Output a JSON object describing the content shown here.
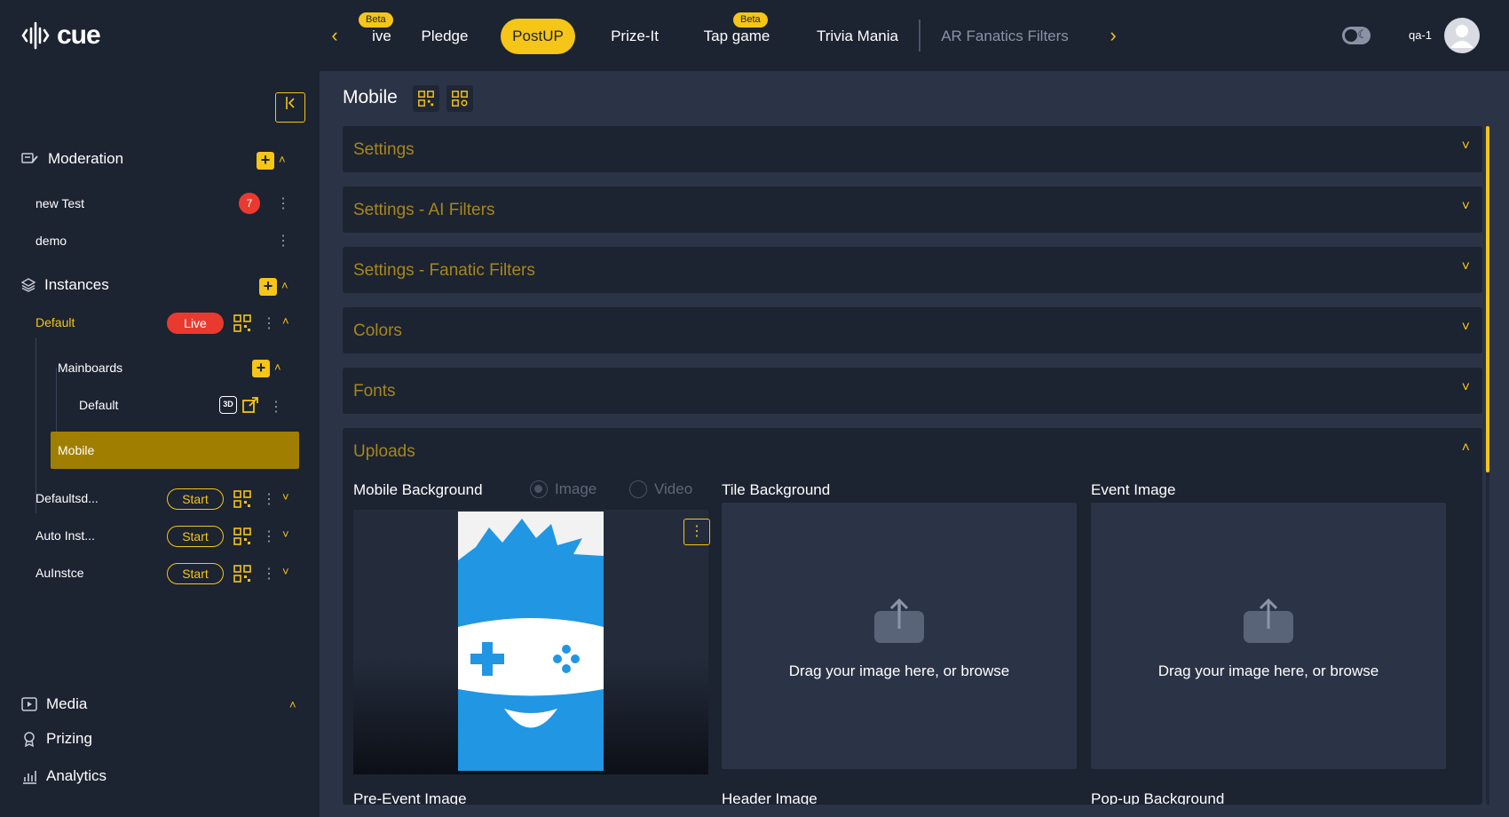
{
  "app": {
    "logo_text": "cue"
  },
  "topnav": {
    "tabs": [
      {
        "label": "ive",
        "beta": "Beta"
      },
      {
        "label": "Pledge"
      },
      {
        "label": "PostUP"
      },
      {
        "label": "Prize-It"
      },
      {
        "label": "Tap game",
        "beta": "Beta"
      },
      {
        "label": "Trivia Mania"
      },
      {
        "label": "AR Fanatics Filters"
      }
    ],
    "user": "qa-1"
  },
  "sidebar": {
    "moderation": {
      "title": "Moderation",
      "items": [
        {
          "label": "new Test",
          "badge": "7"
        },
        {
          "label": "demo"
        }
      ]
    },
    "instances": {
      "title": "Instances",
      "items": [
        {
          "label": "Default",
          "status": "Live"
        },
        {
          "label": "Defaultsd...",
          "status": "Start"
        },
        {
          "label": "Auto Inst...",
          "status": "Start"
        },
        {
          "label": "AuInstce",
          "status": "Start"
        }
      ],
      "mainboards": {
        "title": "Mainboards",
        "items": [
          {
            "label": "Default",
            "tag": "3D"
          }
        ]
      },
      "selected": "Mobile"
    },
    "bottom": [
      {
        "label": "Media"
      },
      {
        "label": "Prizing"
      },
      {
        "label": "Analytics"
      }
    ]
  },
  "main": {
    "title": "Mobile",
    "sections": [
      "Settings",
      "Settings - AI Filters",
      "Settings - Fanatic Filters",
      "Colors",
      "Fonts",
      "Uploads"
    ],
    "uploads": {
      "mobile_background": "Mobile Background",
      "radio_image": "Image",
      "radio_video": "Video",
      "tile_background": "Tile Background",
      "event_image": "Event Image",
      "drop_text": "Drag your image here, or browse",
      "pre_event_image": "Pre-Event Image",
      "header_image": "Header Image",
      "popup_background": "Pop-up Background"
    }
  },
  "colors": {
    "accent": "#f5c518",
    "live": "#ea3a30",
    "sidebar_bg": "#1c2331",
    "main_bg": "#2b3446",
    "selected": "#a07f00"
  }
}
